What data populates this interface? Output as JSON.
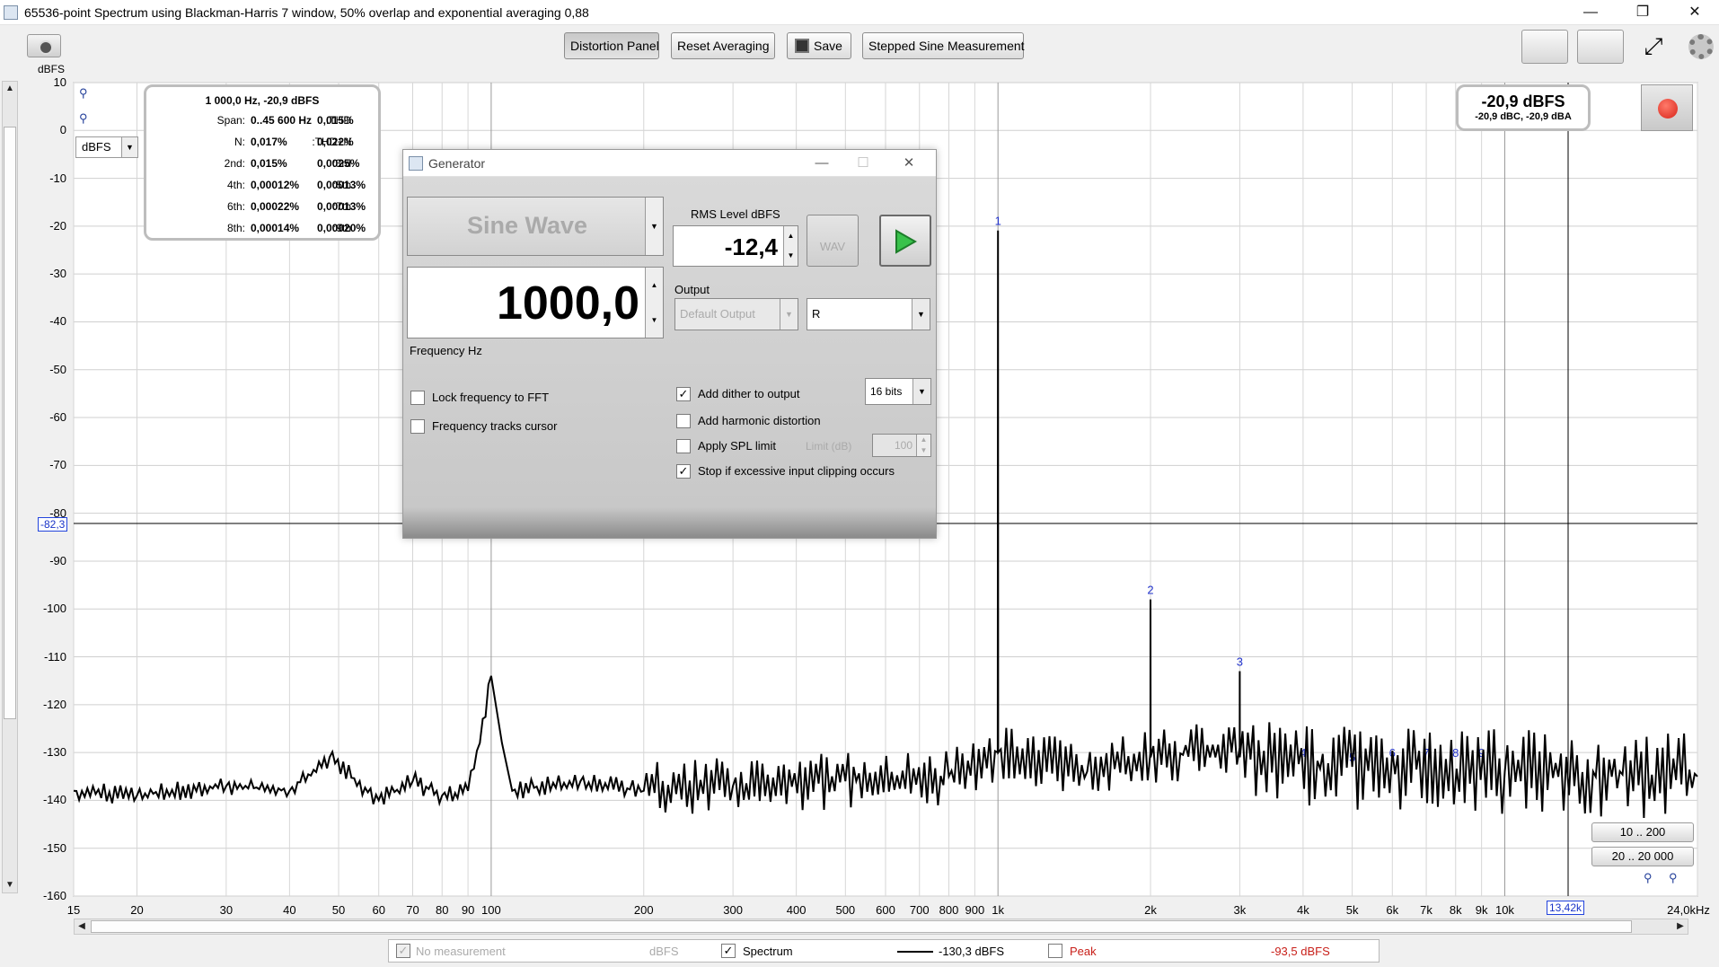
{
  "window": {
    "title": "65536-point Spectrum using Blackman-Harris 7 window, 50% overlap and exponential averaging 0,88",
    "minimize": "—",
    "restore": "❐",
    "close": "✕"
  },
  "toolbar": {
    "distortion_panel": "Distortion Panel",
    "reset_averaging": "Reset Averaging",
    "save": "Save",
    "stepped_sine": "Stepped Sine Measurement"
  },
  "plot": {
    "yunit": "dBFS",
    "unit_select": "dBFS",
    "cursor_y": "-82,3",
    "cursor_x": "13,42k",
    "yticks": [
      "10",
      "0",
      "-10",
      "-20",
      "-30",
      "-40",
      "-50",
      "-60",
      "-70",
      "-80",
      "-90",
      "-100",
      "-110",
      "-120",
      "-130",
      "-140",
      "-150",
      "-160"
    ],
    "xticks": [
      "15",
      "20",
      "30",
      "40",
      "50",
      "60",
      "70",
      "80",
      "90",
      "100",
      "200",
      "300",
      "400",
      "500",
      "600",
      "700",
      "800",
      "900",
      "1k",
      "2k",
      "3k",
      "4k",
      "5k",
      "6k",
      "7k",
      "8k",
      "9k",
      "10k",
      "24,0kHz"
    ],
    "harmonic_markers": [
      "1",
      "2",
      "3",
      "4",
      "5",
      "6",
      "7",
      "8",
      "9"
    ]
  },
  "info": {
    "header": "1 000,0 Hz, -20,9 dBFS",
    "rows": [
      {
        "l1": "Span:",
        "v1": "0..45 600 Hz",
        "l2": "THD:",
        "v2": "0,015%"
      },
      {
        "l1": "N:",
        "v1": "0,017%",
        "l2": "THD+N:",
        "v2": "0,022%"
      },
      {
        "l1": "2nd:",
        "v1": "0,015%",
        "l2": "3rd:",
        "v2": "0,0025%"
      },
      {
        "l1": "4th:",
        "v1": "0,00012%",
        "l2": "5th:",
        "v2": "0,00013%"
      },
      {
        "l1": "6th:",
        "v1": "0,00022%",
        "l2": "7th:",
        "v2": "0,00013%"
      },
      {
        "l1": "8th:",
        "v1": "0,00014%",
        "l2": "9th:",
        "v2": "0,00020%"
      }
    ]
  },
  "level": {
    "main": "-20,9 dBFS",
    "sub": "-20,9 dBC, -20,9 dBA"
  },
  "ranges": {
    "r1": "10 .. 200",
    "r2": "20 .. 20 000"
  },
  "generator": {
    "title": "Generator",
    "waveform": "Sine Wave",
    "rms_label": "RMS Level dBFS",
    "rms_value": "-12,4",
    "wav_label": "WAV",
    "frequency": "1000,0",
    "frequency_label": "Frequency Hz",
    "output_label": "Output",
    "output_device": "Default Output",
    "output_channel": "R",
    "lock_freq": "Lock frequency to FFT",
    "freq_tracks": "Frequency tracks cursor",
    "add_dither": "Add dither to output",
    "dither_bits": "16 bits",
    "add_harmonic": "Add harmonic distortion",
    "apply_spl": "Apply SPL limit",
    "limit_label": "Limit (dB)",
    "limit_value": "100",
    "stop_clipping": "Stop if excessive input clipping occurs"
  },
  "status": {
    "no_measurement": "No measurement",
    "unit1": "dBFS",
    "spectrum": "Spectrum",
    "spectrum_value": "-130,3 dBFS",
    "peak": "Peak",
    "peak_value": "-93,5 dBFS"
  },
  "chart_data": {
    "type": "line",
    "title": "",
    "xlabel": "",
    "ylabel": "dBFS",
    "xscale": "log",
    "xlim": [
      15,
      24000
    ],
    "ylim": [
      -160,
      10
    ],
    "series": [
      {
        "name": "Spectrum",
        "x": [
          15,
          20,
          30,
          40,
          48,
          60,
          70,
          80,
          90,
          95,
          100,
          105,
          110,
          150,
          200,
          300,
          500,
          800,
          999,
          1000,
          1001,
          1500,
          1999,
          2000,
          2001,
          2999,
          3000,
          3001,
          5000,
          10000,
          24000
        ],
        "y": [
          -138,
          -139,
          -137,
          -138,
          -131,
          -140,
          -136,
          -139,
          -138,
          -128,
          -114,
          -128,
          -138,
          -136,
          -138,
          -137,
          -136,
          -135,
          -130,
          -20.9,
          -130,
          -134,
          -130,
          -98,
          -131,
          -129,
          -113,
          -131,
          -133,
          -134,
          -135
        ]
      }
    ]
  }
}
